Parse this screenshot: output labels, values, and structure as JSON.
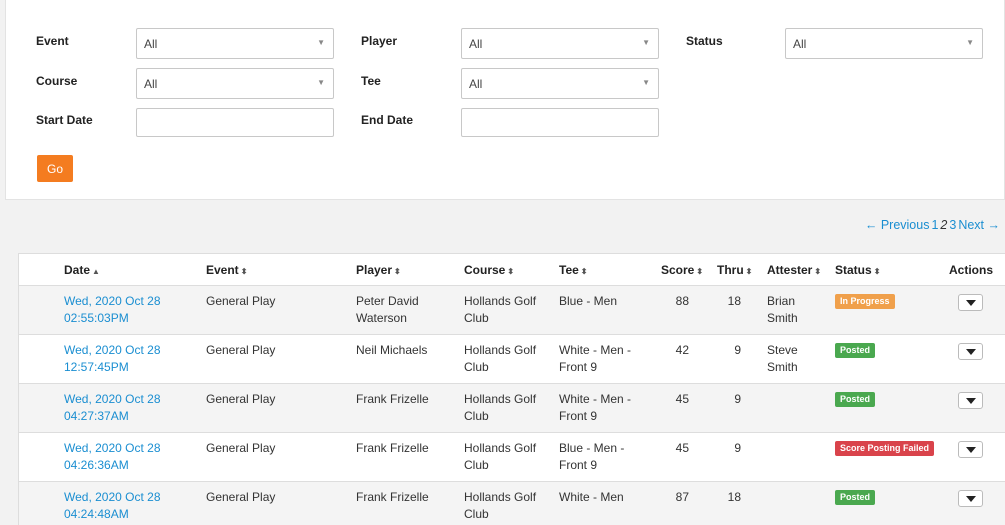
{
  "filters": {
    "event": {
      "label": "Event",
      "value": "All"
    },
    "player": {
      "label": "Player",
      "value": "All"
    },
    "status": {
      "label": "Status",
      "value": "All"
    },
    "course": {
      "label": "Course",
      "value": "All"
    },
    "tee": {
      "label": "Tee",
      "value": "All"
    },
    "start_date": {
      "label": "Start Date",
      "value": ""
    },
    "end_date": {
      "label": "End Date",
      "value": ""
    },
    "go_label": "Go"
  },
  "pagination": {
    "previous": "← Previous",
    "pages": [
      "1",
      "2",
      "3"
    ],
    "current": "2",
    "next": "Next →"
  },
  "table": {
    "columns": [
      "Date",
      "Event",
      "Player",
      "Course",
      "Tee",
      "Score",
      "Thru",
      "Attester",
      "Status",
      "Actions"
    ],
    "rows": [
      {
        "date1": "Wed, 2020 Oct 28",
        "date2": "02:55:03PM",
        "event": "General Play",
        "player1": "Peter David",
        "player2": "Waterson",
        "course1": "Hollands Golf",
        "course2": "Club",
        "tee1": "Blue - Men",
        "tee2": "",
        "score": "88",
        "thru": "18",
        "attester1": "Brian",
        "attester2": "Smith",
        "status": "In Progress",
        "status_color": "#f0a04b"
      },
      {
        "date1": "Wed, 2020 Oct 28",
        "date2": "12:57:45PM",
        "event": "General Play",
        "player1": "Neil Michaels",
        "player2": "",
        "course1": "Hollands Golf",
        "course2": "Club",
        "tee1": "White - Men -",
        "tee2": "Front 9",
        "score": "42",
        "thru": "9",
        "attester1": "Steve",
        "attester2": "Smith",
        "status": "Posted",
        "status_color": "#4aa84f"
      },
      {
        "date1": "Wed, 2020 Oct 28",
        "date2": "04:27:37AM",
        "event": "General Play",
        "player1": "Frank Frizelle",
        "player2": "",
        "course1": "Hollands Golf",
        "course2": "Club",
        "tee1": "White - Men -",
        "tee2": "Front 9",
        "score": "45",
        "thru": "9",
        "attester1": "",
        "attester2": "",
        "status": "Posted",
        "status_color": "#4aa84f"
      },
      {
        "date1": "Wed, 2020 Oct 28",
        "date2": "04:26:36AM",
        "event": "General Play",
        "player1": "Frank Frizelle",
        "player2": "",
        "course1": "Hollands Golf",
        "course2": "Club",
        "tee1": "Blue - Men -",
        "tee2": "Front 9",
        "score": "45",
        "thru": "9",
        "attester1": "",
        "attester2": "",
        "status": "Score Posting Failed",
        "status_color": "#d9434b"
      },
      {
        "date1": "Wed, 2020 Oct 28",
        "date2": "04:24:48AM",
        "event": "General Play",
        "player1": "Frank Frizelle",
        "player2": "",
        "course1": "Hollands Golf",
        "course2": "Club",
        "tee1": "White - Men",
        "tee2": "",
        "score": "87",
        "thru": "18",
        "attester1": "",
        "attester2": "",
        "status": "Posted",
        "status_color": "#4aa84f"
      }
    ]
  }
}
